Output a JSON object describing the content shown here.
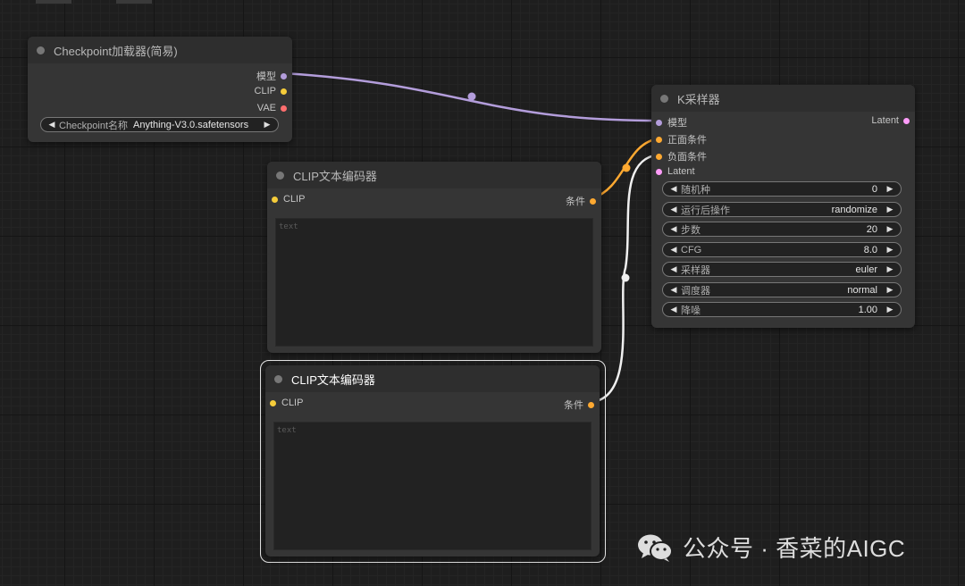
{
  "colors": {
    "model": "#b39ddb",
    "clip": "#f5cc3a",
    "vae": "#ff6e6e",
    "conditioning": "#ffa931",
    "latent": "#ff9cf9",
    "white_link": "#f0f0f0"
  },
  "checkpoint_loader": {
    "title": "Checkpoint加载器(简易)",
    "outputs": [
      "模型",
      "CLIP",
      "VAE"
    ],
    "widget": {
      "name": "Checkpoint名称",
      "value": "Anything-V3.0.safetensors"
    }
  },
  "clip_encoder_positive": {
    "title": "CLIP文本编码器",
    "input": "CLIP",
    "output": "条件",
    "text_placeholder": "text"
  },
  "clip_encoder_negative": {
    "title": "CLIP文本编码器",
    "input": "CLIP",
    "output": "条件",
    "text_placeholder": "text"
  },
  "ksampler": {
    "title": "K采样器",
    "inputs": [
      "模型",
      "正面条件",
      "负面条件",
      "Latent"
    ],
    "output": "Latent",
    "widgets": [
      {
        "name": "随机种",
        "value": "0"
      },
      {
        "name": "运行后操作",
        "value": "randomize"
      },
      {
        "name": "步数",
        "value": "20"
      },
      {
        "name": "CFG",
        "value": "8.0"
      },
      {
        "name": "采样器",
        "value": "euler"
      },
      {
        "name": "调度器",
        "value": "normal"
      },
      {
        "name": "降噪",
        "value": "1.00"
      }
    ]
  },
  "watermark": {
    "text": "公众号 · 香菜的AIGC",
    "icon": "wechat-icon"
  }
}
